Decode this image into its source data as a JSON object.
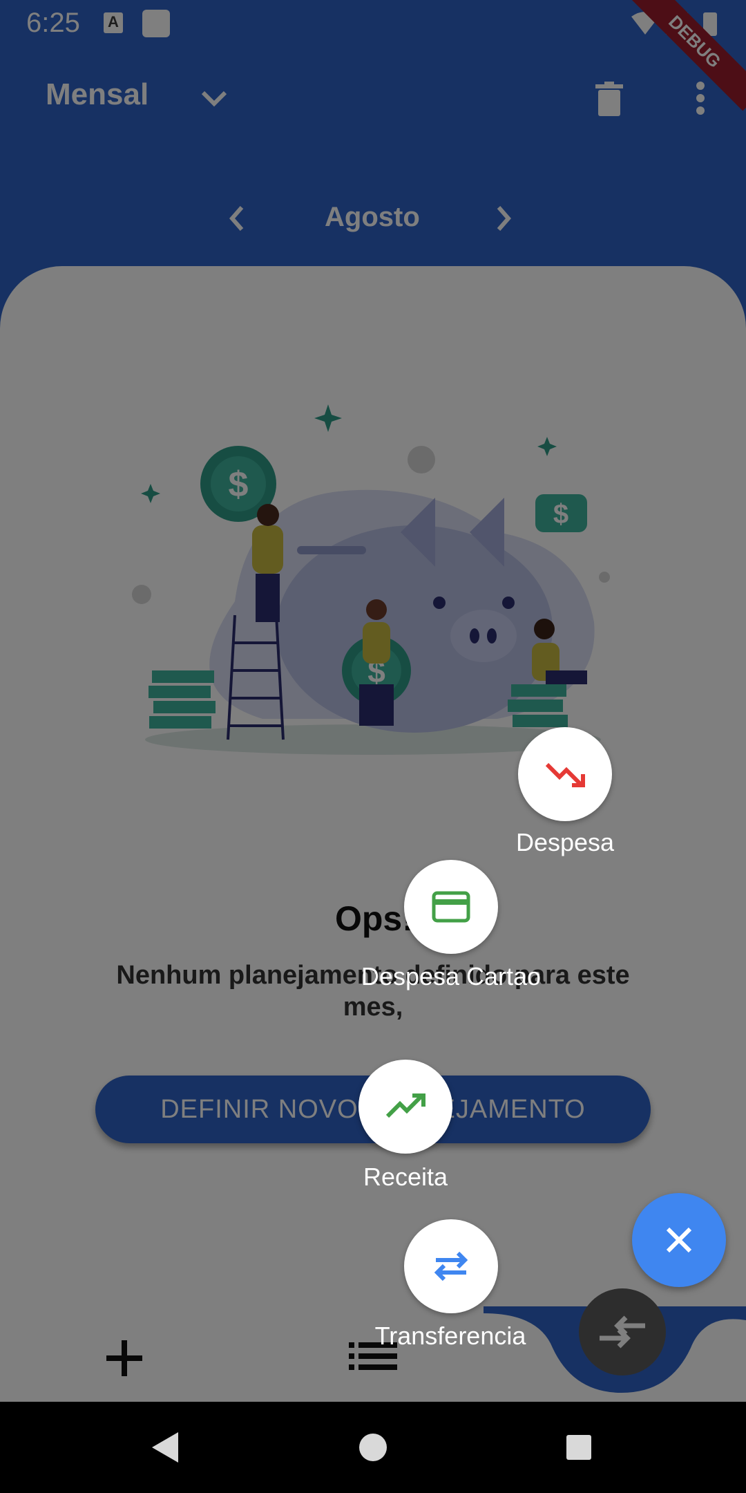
{
  "status_bar": {
    "time": "6:25",
    "debug_banner": "DEBUG"
  },
  "app_bar": {
    "title": "Mensal",
    "month": "Agosto"
  },
  "empty_state": {
    "title": "Ops!",
    "message": "Nenhum planejamento definido para este mes,",
    "button": "DEFINIR NOVO PLANEJAMENTO"
  },
  "speed_dial": {
    "items": [
      {
        "label": "Despesa",
        "icon": "trending-down-icon",
        "color": "#e53935"
      },
      {
        "label": "Despesa Cartao",
        "icon": "credit-card-icon",
        "color": "#43a047"
      },
      {
        "label": "Receita",
        "icon": "trending-up-icon",
        "color": "#43a047"
      },
      {
        "label": "Transferencia",
        "icon": "swap-arrows-icon",
        "color": "#3f86f0"
      }
    ]
  },
  "colors": {
    "primary": "#2f63c6",
    "fab": "#3f86f0"
  }
}
